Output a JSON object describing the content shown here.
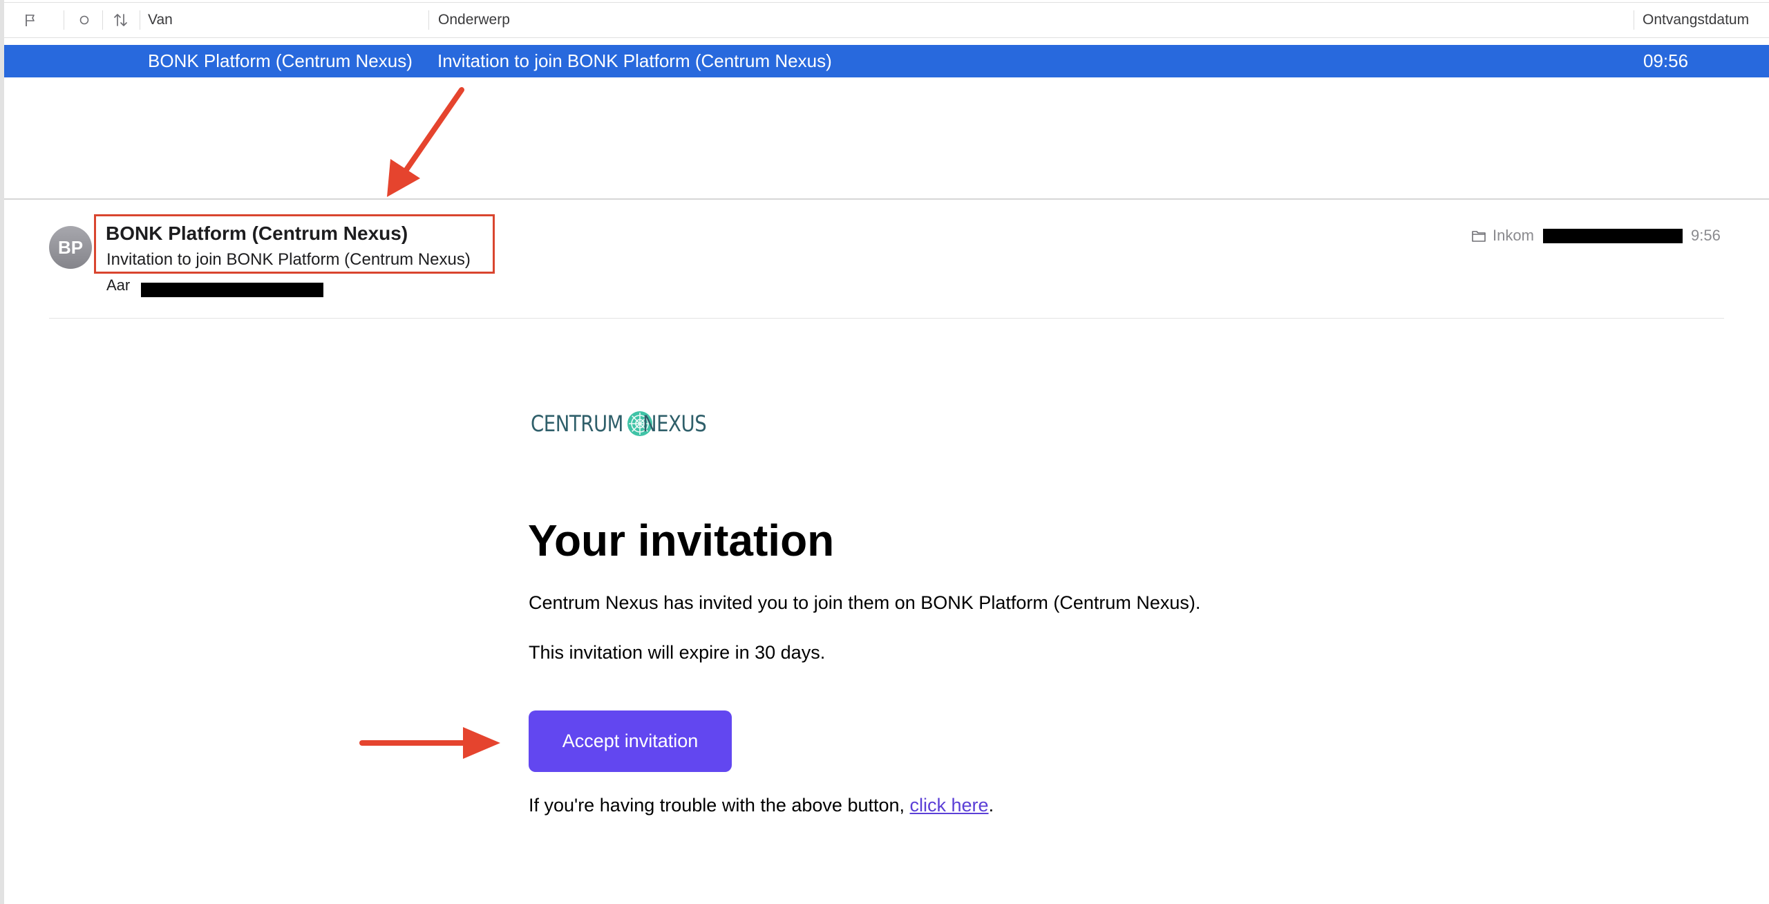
{
  "list": {
    "columns": {
      "from": "Van",
      "subject": "Onderwerp",
      "received": "Ontvangstdatum"
    },
    "selected_row": {
      "from": "BONK Platform (Centrum Nexus)",
      "subject": "Invitation to join BONK Platform (Centrum Nexus)",
      "time": "09:56"
    }
  },
  "message": {
    "avatar_initials": "BP",
    "sender": "BONK Platform (Centrum Nexus)",
    "subject": "Invitation to join BONK Platform (Centrum Nexus)",
    "to_label": "Aar",
    "folder": "Inkom",
    "time": "9:56"
  },
  "email": {
    "logo": {
      "left_word": "CENTRUM",
      "right_word": "NEXUS"
    },
    "title": "Your invitation",
    "paragraph1": "Centrum Nexus has invited you to join them on BONK Platform (Centrum Nexus).",
    "paragraph2": "This invitation will expire in 30 days.",
    "button_label": "Accept invitation",
    "trouble_prefix": "If you're having trouble with the above button, ",
    "trouble_link": "click here",
    "trouble_suffix": "."
  },
  "colors": {
    "selection": "#2869dd",
    "button": "#6247f0",
    "annotation": "#d9452f",
    "logo_text": "#2f5f6a",
    "logo_mark": "#3fc3a6"
  },
  "icons": [
    "flag-icon",
    "unread-dot-icon",
    "sort-arrows-icon",
    "folder-icon"
  ]
}
